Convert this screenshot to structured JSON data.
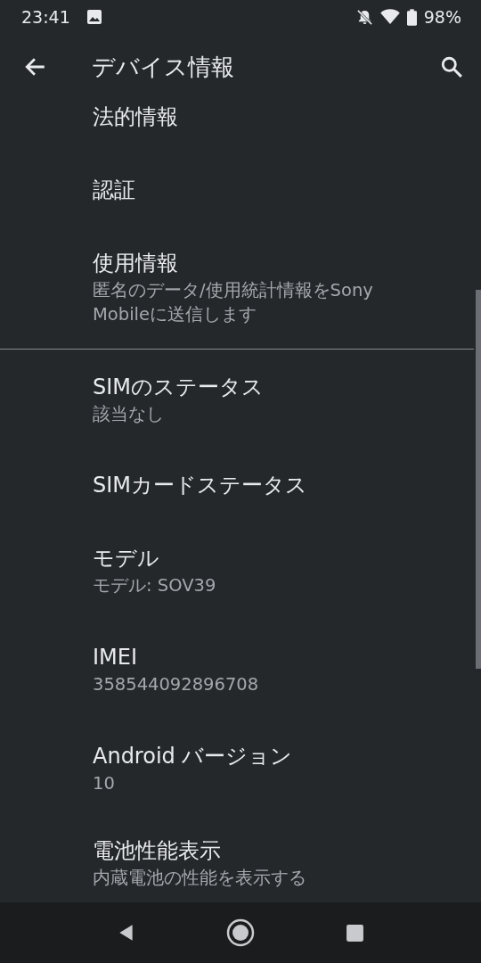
{
  "status_bar": {
    "time": "23:41",
    "battery_text": "98%"
  },
  "app_bar": {
    "title": "デバイス情報"
  },
  "items": [
    {
      "title": "法的情報",
      "kind": "top"
    },
    {
      "title": "認証",
      "kind": "plain"
    },
    {
      "title": "使用情報",
      "summary": "匿名のデータ/使用統計情報をSony Mobileに送信します",
      "kind": "plain"
    },
    {
      "kind": "divider"
    },
    {
      "title": "SIMのステータス",
      "summary": "該当なし",
      "kind": "plain"
    },
    {
      "title": "SIMカードステータス",
      "kind": "plain"
    },
    {
      "title": "モデル",
      "summary": "モデル: SOV39",
      "kind": "plain"
    },
    {
      "title": "IMEI",
      "summary": "358544092896708",
      "kind": "plain"
    },
    {
      "title": "Android バージョン",
      "summary": "10",
      "kind": "plain"
    },
    {
      "title": "電池性能表示",
      "summary": "内蔵電池の性能を表示する",
      "kind": "bottom"
    }
  ]
}
